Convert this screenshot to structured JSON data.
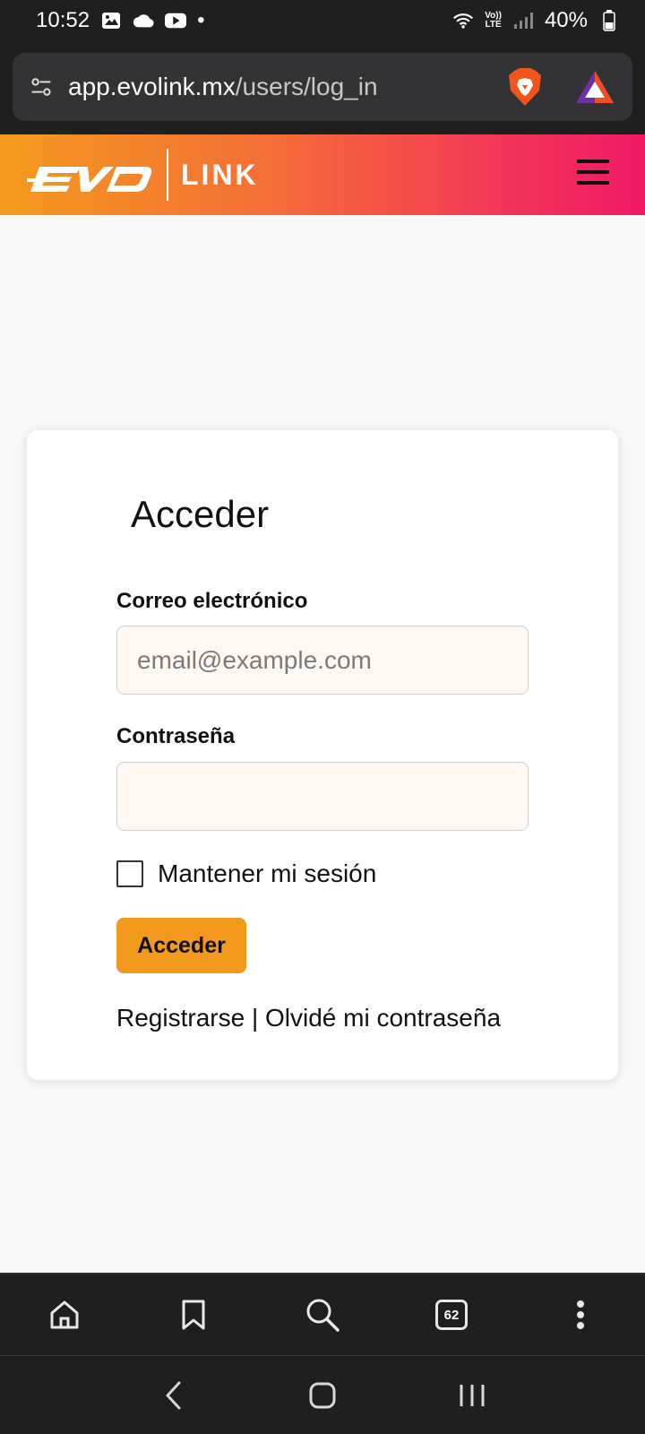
{
  "status_bar": {
    "time": "10:52",
    "dot": "•",
    "network_top": "Vo))",
    "network_bottom": "LTE",
    "battery": "40%"
  },
  "browser": {
    "url_host": "app.evolink.mx",
    "url_path": "/users/log_in",
    "tab_count": "62"
  },
  "header": {
    "logo_word": "LINK",
    "brand_gradient": [
      "#f39a1d",
      "#f56a3a",
      "#f33a55",
      "#f01865"
    ]
  },
  "login": {
    "title": "Acceder",
    "email_label": "Correo electrónico",
    "email_placeholder": "email@example.com",
    "email_value": "",
    "password_label": "Contraseña",
    "password_value": "",
    "remember_label": "Mantener mi sesión",
    "remember_checked": false,
    "submit_label": "Acceder",
    "register_link": "Registrarse",
    "separator": " | ",
    "forgot_link": "Olvidé mi contraseña"
  },
  "colors": {
    "accent": "#f3991e",
    "input_bg": "#fff8f2",
    "chrome_bg": "#1f1f1f"
  },
  "icons": {
    "status": [
      "gallery-icon",
      "cloud-icon",
      "youtube-icon",
      "wifi-icon",
      "signal-icon",
      "battery-icon"
    ],
    "browser": [
      "site-settings-icon",
      "brave-shield-icon",
      "brave-rewards-icon"
    ],
    "toolbar": [
      "home-icon",
      "bookmark-icon",
      "search-icon",
      "tabs-icon",
      "more-icon"
    ],
    "nav": [
      "back-icon",
      "home-nav-icon",
      "recents-icon"
    ]
  }
}
